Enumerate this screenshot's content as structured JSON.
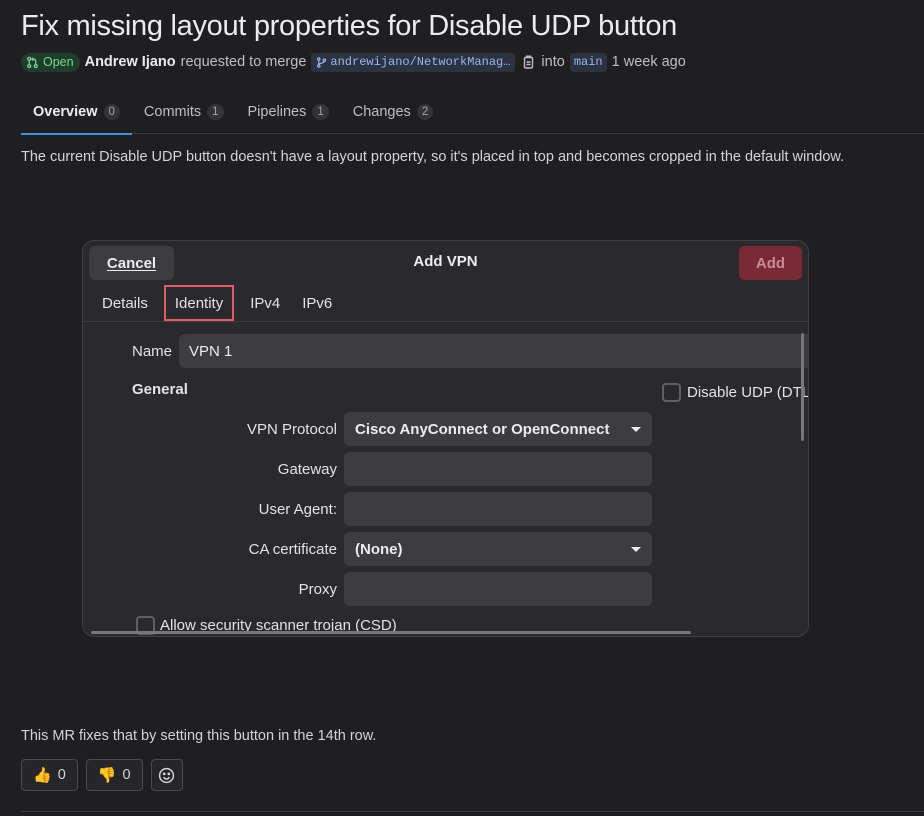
{
  "mr": {
    "title": "Fix missing layout properties for Disable UDP button",
    "status": "Open",
    "author": "Andrew Ijano",
    "action_text": "requested to merge",
    "source_branch": "andrewijano/NetworkManag…",
    "into_text": "into",
    "target_branch": "main",
    "time_ago": "1 week ago"
  },
  "tabs": [
    {
      "label": "Overview",
      "count": "0"
    },
    {
      "label": "Commits",
      "count": "1"
    },
    {
      "label": "Pipelines",
      "count": "1"
    },
    {
      "label": "Changes",
      "count": "2"
    }
  ],
  "description": "The current Disable UDP button doesn't have a layout property, so it's placed in top and becomes cropped in the default window.",
  "dialog": {
    "cancel_label": "Cancel",
    "title": "Add VPN",
    "add_label": "Add",
    "tabs": [
      "Details",
      "Identity",
      "IPv4",
      "IPv6"
    ],
    "name_label": "Name",
    "name_value": "VPN 1",
    "general_label": "General",
    "disable_udp_label": "Disable UDP (DTL",
    "vpn_protocol_label": "VPN Protocol",
    "vpn_protocol_value": "Cisco AnyConnect or OpenConnect",
    "gateway_label": "Gateway",
    "user_agent_label": "User Agent:",
    "ca_cert_label": "CA certificate",
    "ca_cert_value": "(None)",
    "proxy_label": "Proxy",
    "csd_label": "Allow security scanner trojan (CSD)"
  },
  "footer": {
    "text": "This MR fixes that by setting this button in the 14th row.",
    "thumbs_up_count": "0",
    "thumbs_down_count": "0"
  },
  "colors": {
    "accent": "#428fdc",
    "open_badge": "#7fd39a",
    "highlight_outline": "#e05b6a",
    "add_button": "#7a2a36"
  }
}
